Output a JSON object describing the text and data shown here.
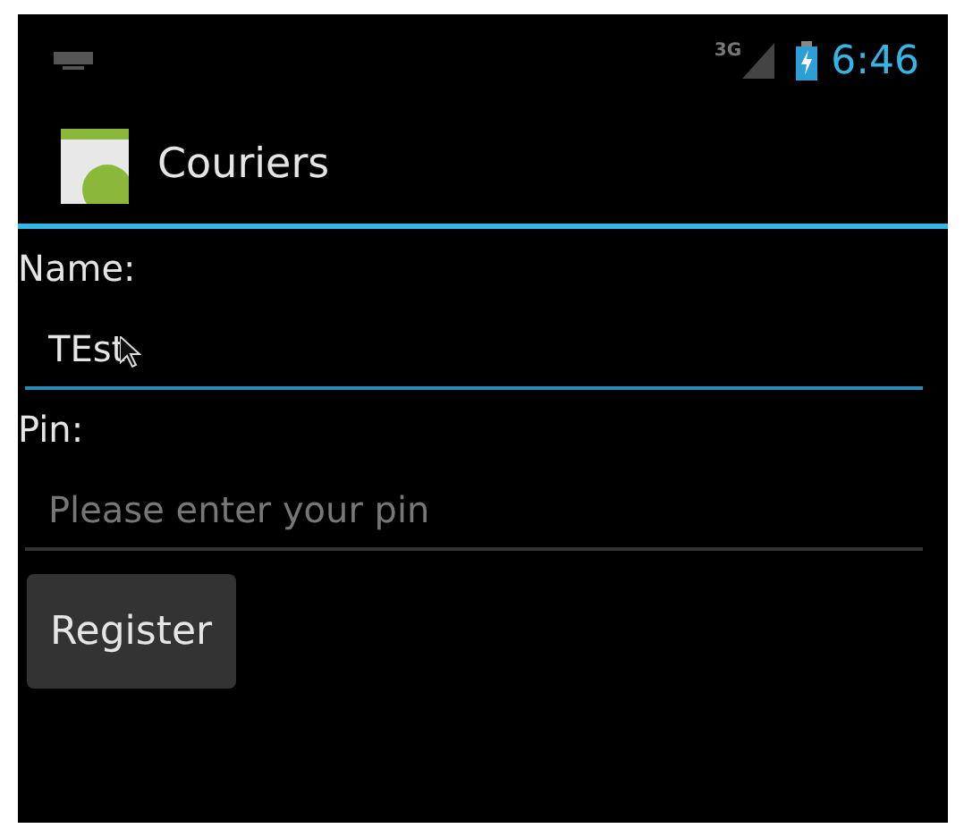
{
  "status_bar": {
    "network": "3G",
    "time": "6:46"
  },
  "action_bar": {
    "title": "Couriers"
  },
  "form": [
    {
      "label": "Name:",
      "value": "TEst",
      "focused": true
    },
    {
      "label": "Pin:",
      "placeholder": "Please enter your pin",
      "focused": false
    }
  ],
  "button": "Register"
}
